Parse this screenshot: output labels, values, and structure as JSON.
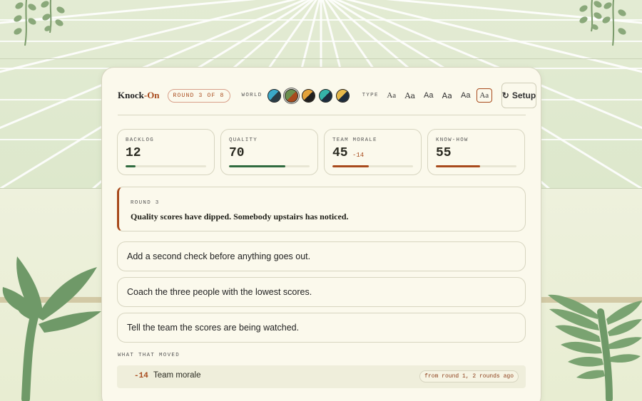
{
  "brand": {
    "name": "Knock",
    "dash": "-",
    "accent": "On"
  },
  "round_pill": "ROUND 3 OF 8",
  "world": {
    "label": "WORLD",
    "swatches": [
      {
        "name": "sky-teal",
        "a": "#3aa8c8",
        "b": "#2b3b44",
        "selected": false
      },
      {
        "name": "olive-rust",
        "a": "#6b8f4e",
        "b": "#a84a1c",
        "selected": true
      },
      {
        "name": "amber-black",
        "a": "#e3a23a",
        "b": "#1f1f1f",
        "selected": false
      },
      {
        "name": "teal-navy",
        "a": "#35b3a8",
        "b": "#1d2b3c",
        "selected": false
      },
      {
        "name": "gold-navy",
        "a": "#e6b84a",
        "b": "#1d2b3c",
        "selected": false
      }
    ]
  },
  "type": {
    "label": "TYPE",
    "options": [
      "Aa",
      "Aa",
      "Aa",
      "Aa",
      "Aa",
      "Aa"
    ],
    "selected_index": 5
  },
  "setup_button": {
    "icon": "↻",
    "label": "Setup"
  },
  "stats": [
    {
      "label": "BACKLOG",
      "value": "12",
      "delta": "",
      "level": 0.12,
      "color": "#2f6b3f"
    },
    {
      "label": "QUALITY",
      "value": "70",
      "delta": "",
      "level": 0.7,
      "color": "#2f6b3f"
    },
    {
      "label": "TEAM MORALE",
      "value": "45",
      "delta": "-14",
      "level": 0.45,
      "color": "#a84a1c"
    },
    {
      "label": "KNOW-HOW",
      "value": "55",
      "delta": "",
      "level": 0.55,
      "color": "#a84a1c"
    }
  ],
  "event": {
    "eyebrow": "ROUND 3",
    "message": "Quality scores have dipped. Somebody upstairs has noticed."
  },
  "choices": [
    "Add a second check before anything goes out.",
    "Coach the three people with the lowest scores.",
    "Tell the team the scores are being watched."
  ],
  "moved": {
    "label": "WHAT THAT MOVED",
    "delta": "-14",
    "name": "Team morale",
    "origin": "from round 1, 2 rounds ago"
  },
  "colors": {
    "accent": "#a84a1c",
    "good": "#2f6b3f",
    "card": "#fbf9ec"
  }
}
